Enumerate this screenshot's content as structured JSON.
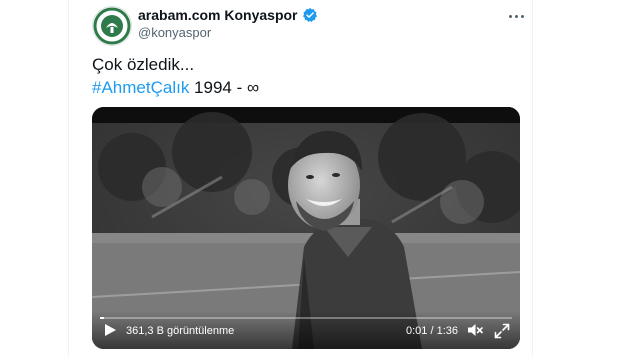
{
  "author": {
    "display_name": "arabam.com Konyaspor",
    "handle": "@konyaspor",
    "verified": true,
    "avatar_text": "KONYASPOR"
  },
  "tweet": {
    "line1": "Çok özledik...",
    "hashtag": "#AhmetÇalık",
    "line2_rest": " 1994 - ∞"
  },
  "video": {
    "views": "361,3 B görüntülenme",
    "time": "0:01 / 1:36",
    "progress": 0.01
  },
  "colors": {
    "accent": "#1d9bf0",
    "verified": "#1d9bf0",
    "text": "#0f1419",
    "muted": "#536471",
    "badge_green": "#2f7a4a"
  },
  "icons": {
    "more": "more-icon",
    "verified": "verified-badge-icon",
    "play": "play-icon",
    "volume": "volume-icon",
    "fullscreen": "fullscreen-icon"
  }
}
